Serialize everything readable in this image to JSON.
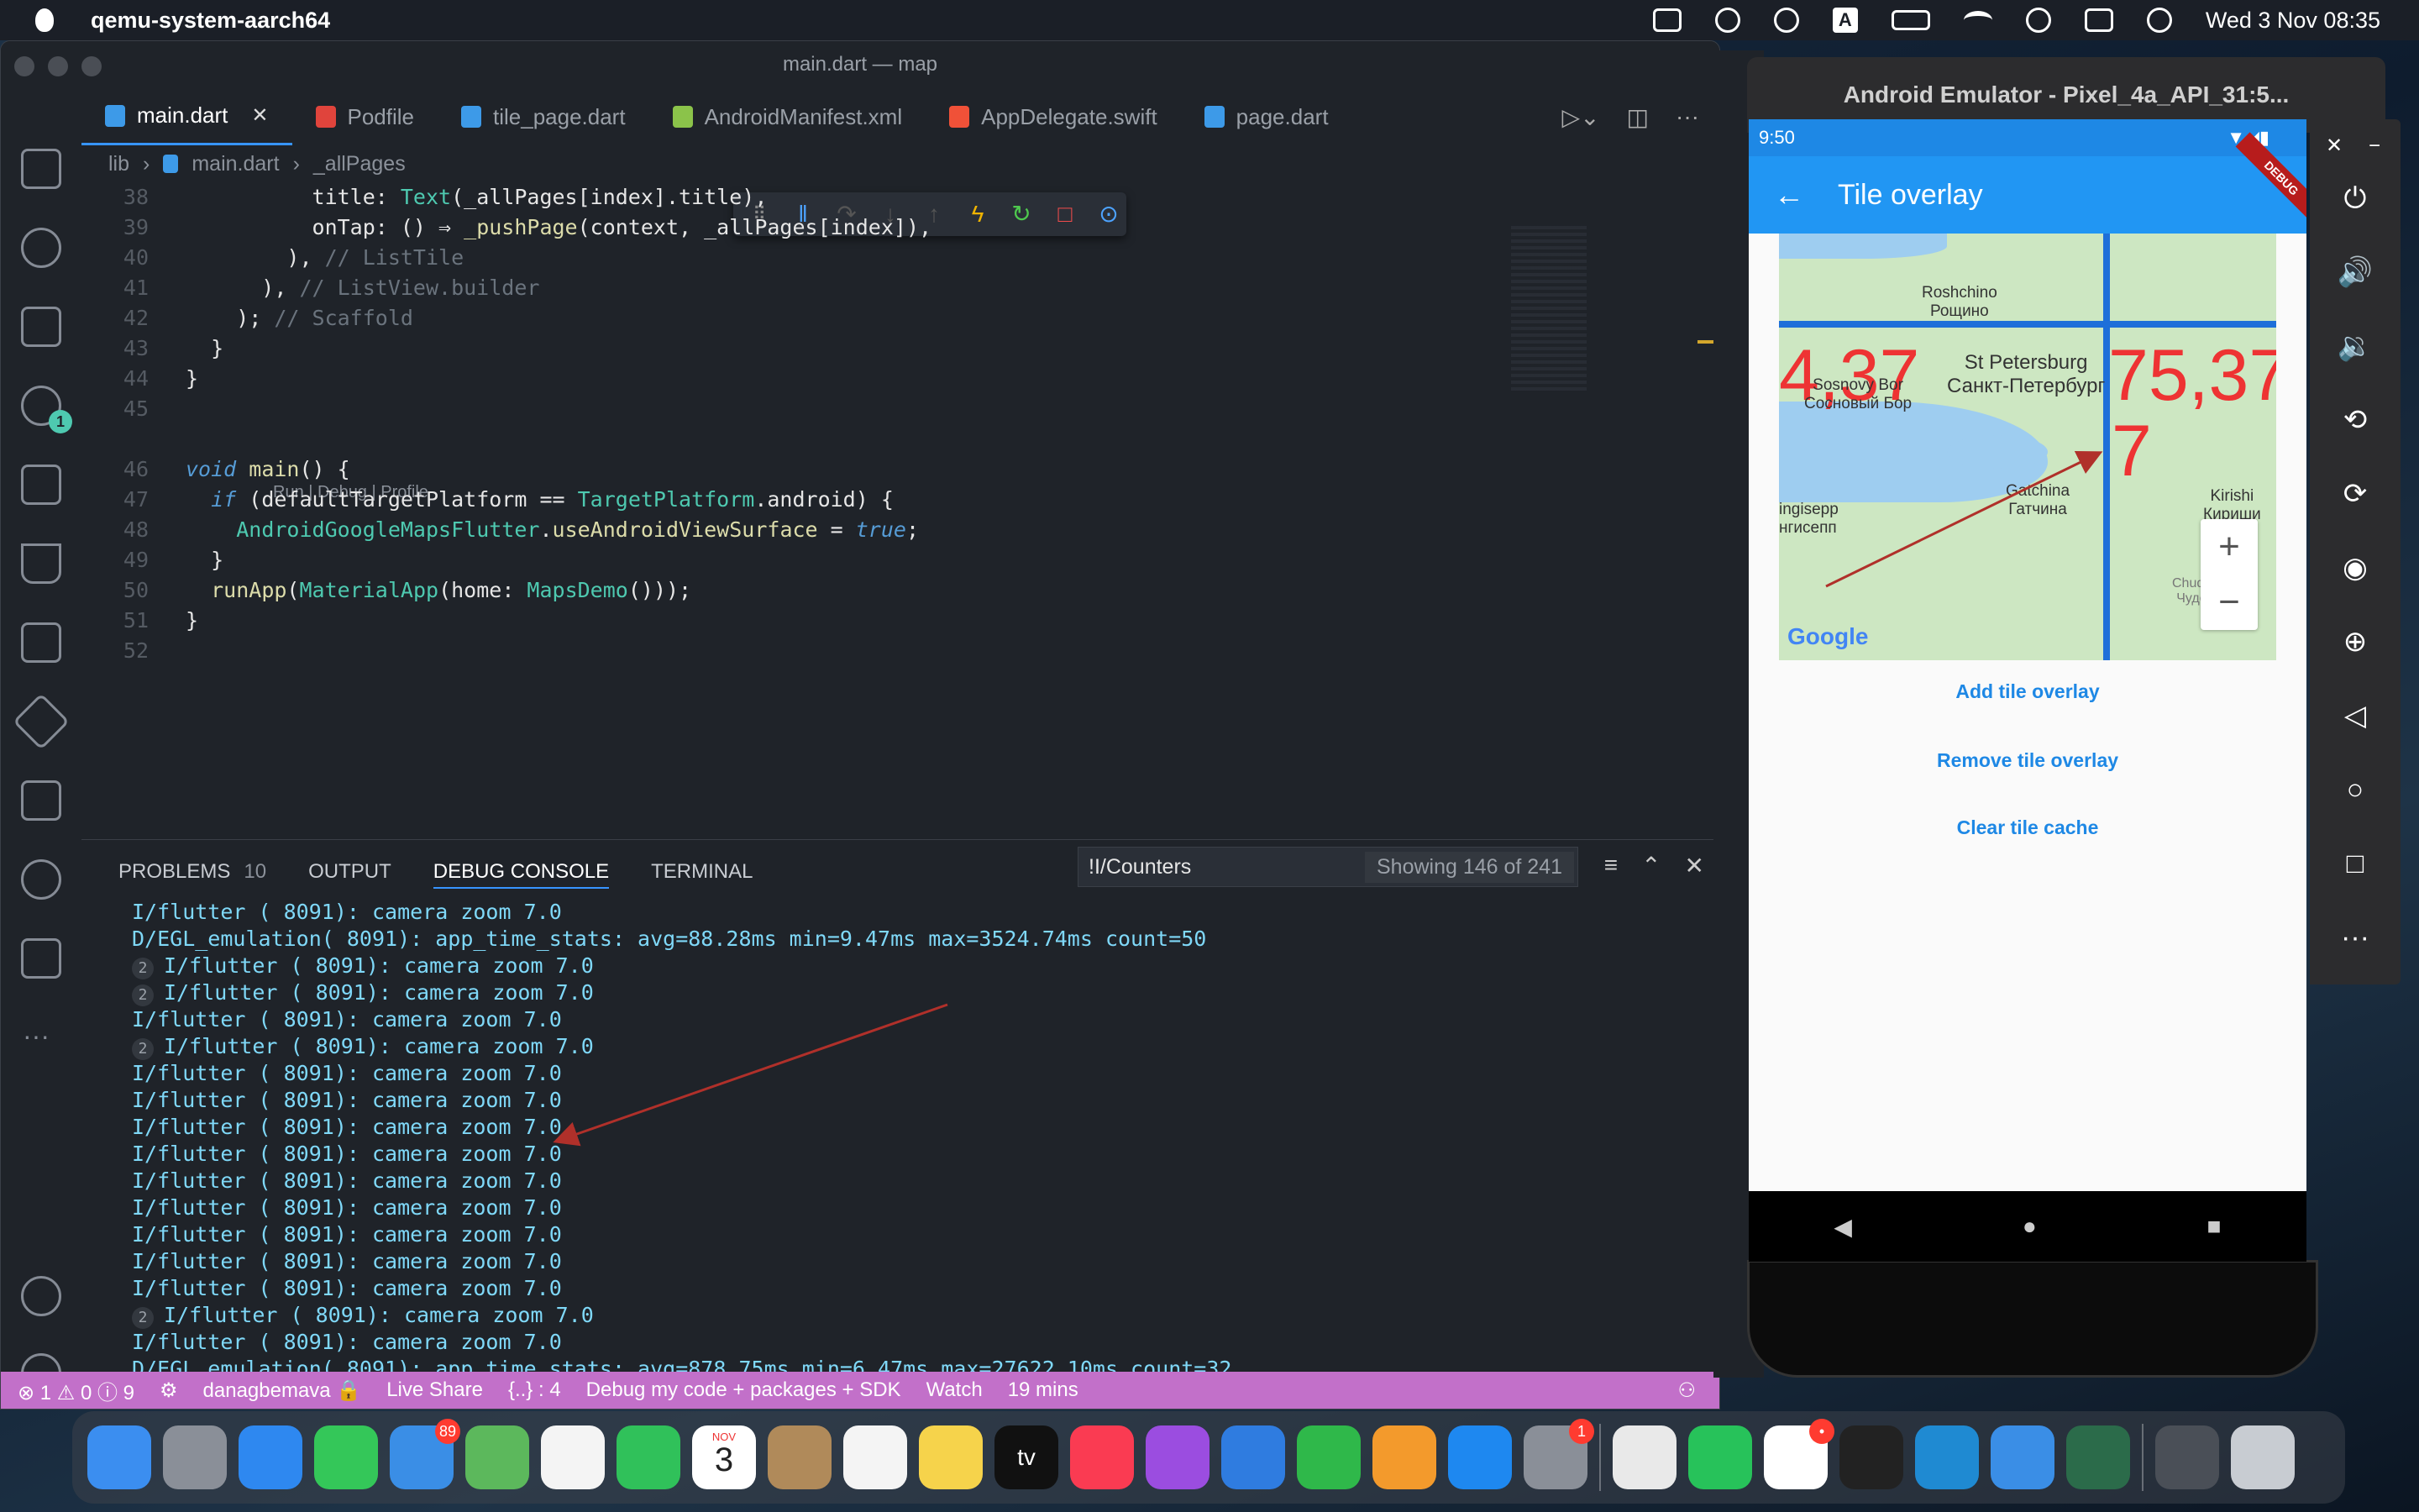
{
  "menubar": {
    "app": "qemu-system-aarch64",
    "datetime": "Wed 3 Nov  08:35",
    "input_icon": "A"
  },
  "vscode": {
    "window_title": "main.dart — map",
    "tabs": [
      {
        "label": "main.dart",
        "icon_color": "#3d9ae8",
        "active": true
      },
      {
        "label": "Podfile",
        "icon_color": "#e0443c",
        "active": false
      },
      {
        "label": "tile_page.dart",
        "icon_color": "#3d9ae8",
        "active": false
      },
      {
        "label": "AndroidManifest.xml",
        "icon_color": "#8bc34a",
        "active": false
      },
      {
        "label": "AppDelegate.swift",
        "icon_color": "#f05138",
        "active": false
      },
      {
        "label": "page.dart",
        "icon_color": "#3d9ae8",
        "active": false
      }
    ],
    "breadcrumb": [
      "lib",
      "main.dart",
      "_allPages"
    ],
    "codelens": "Run | Debug | Profile",
    "code": [
      {
        "ln": "38",
        "text": "          title: Text(_allPages[index].title),"
      },
      {
        "ln": "39",
        "text": "          onTap: () ⇒ _pushPage(context, _allPages[index]),"
      },
      {
        "ln": "40",
        "text": "        ), // ListTile"
      },
      {
        "ln": "41",
        "text": "      ), // ListView.builder"
      },
      {
        "ln": "42",
        "text": "    ); // Scaffold"
      },
      {
        "ln": "43",
        "text": "  }"
      },
      {
        "ln": "44",
        "text": "}"
      },
      {
        "ln": "45",
        "text": ""
      },
      {
        "ln": "46",
        "text": "void main() {"
      },
      {
        "ln": "47",
        "text": "  if (defaultTargetPlatform == TargetPlatform.android) {"
      },
      {
        "ln": "48",
        "text": "    AndroidGoogleMapsFlutter.useAndroidViewSurface = true;"
      },
      {
        "ln": "49",
        "text": "  }"
      },
      {
        "ln": "50",
        "text": "  runApp(MaterialApp(home: MapsDemo()));"
      },
      {
        "ln": "51",
        "text": "}"
      },
      {
        "ln": "52",
        "text": ""
      }
    ],
    "panel": {
      "tabs": [
        {
          "label": "PROBLEMS",
          "count": "10"
        },
        {
          "label": "OUTPUT",
          "count": ""
        },
        {
          "label": "DEBUG CONSOLE",
          "count": ""
        },
        {
          "label": "TERMINAL",
          "count": ""
        }
      ],
      "filter_value": "!I/Counters",
      "showing": "Showing 146 of 241",
      "console": [
        {
          "rep": "",
          "text": "I/flutter ( 8091): camera zoom 7.0"
        },
        {
          "rep": "",
          "text": "D/EGL_emulation( 8091): app_time_stats: avg=88.28ms min=9.47ms max=3524.74ms count=50"
        },
        {
          "rep": "2",
          "text": "I/flutter ( 8091): camera zoom 7.0"
        },
        {
          "rep": "2",
          "text": "I/flutter ( 8091): camera zoom 7.0"
        },
        {
          "rep": "",
          "text": "I/flutter ( 8091): camera zoom 7.0"
        },
        {
          "rep": "2",
          "text": "I/flutter ( 8091): camera zoom 7.0"
        },
        {
          "rep": "",
          "text": "I/flutter ( 8091): camera zoom 7.0"
        },
        {
          "rep": "",
          "text": "I/flutter ( 8091): camera zoom 7.0"
        },
        {
          "rep": "",
          "text": "I/flutter ( 8091): camera zoom 7.0"
        },
        {
          "rep": "",
          "text": "I/flutter ( 8091): camera zoom 7.0"
        },
        {
          "rep": "",
          "text": "I/flutter ( 8091): camera zoom 7.0"
        },
        {
          "rep": "",
          "text": "I/flutter ( 8091): camera zoom 7.0"
        },
        {
          "rep": "",
          "text": "I/flutter ( 8091): camera zoom 7.0"
        },
        {
          "rep": "",
          "text": "I/flutter ( 8091): camera zoom 7.0"
        },
        {
          "rep": "",
          "text": "I/flutter ( 8091): camera zoom 7.0"
        },
        {
          "rep": "2",
          "text": "I/flutter ( 8091): camera zoom 7.0"
        },
        {
          "rep": "",
          "text": "I/flutter ( 8091): camera zoom 7.0"
        },
        {
          "rep": "",
          "text": "D/EGL_emulation( 8091): app_time_stats: avg=878.75ms min=6.47ms max=27622.10ms count=32"
        }
      ]
    },
    "statusbar": {
      "problems": "⊗ 1 ⚠ 0 ⓘ 9",
      "user": "danagbemava 🔒",
      "live_share": "Live Share",
      "brackets": "{..} : 4",
      "debug_mode": "Debug my code + packages + SDK",
      "watch": "Watch",
      "time": "19 mins"
    }
  },
  "emulator": {
    "window_title": "Android Emulator - Pixel_4a_API_31:5...",
    "time": "9:50",
    "debug_banner": "DEBUG",
    "app_title": "Tile overlay",
    "map": {
      "places": [
        {
          "name": "Roshchino\nРощино"
        },
        {
          "name": "St Petersburg\nСанкт-Петербург"
        },
        {
          "name": "Sosnovy Bor\nСосновый Бор"
        },
        {
          "name": "Gatchina\nГатчина"
        },
        {
          "name": "ingisepp\nнгисепп"
        },
        {
          "name": "Kirishi\nКириши"
        },
        {
          "name": "Chudovo\nЧудово"
        }
      ],
      "tile_labels": [
        "4,37",
        "75,37",
        "7"
      ],
      "google": "Google",
      "zoom_in": "+",
      "zoom_out": "−"
    },
    "buttons": [
      "Add tile overlay",
      "Remove tile overlay",
      "Clear tile cache"
    ]
  },
  "dock": {
    "apps": [
      {
        "name": "finder",
        "color": "#3b8ef0",
        "badge": ""
      },
      {
        "name": "launchpad",
        "color": "#8a8f98",
        "badge": ""
      },
      {
        "name": "safari",
        "color": "#2e88f0",
        "badge": ""
      },
      {
        "name": "messages",
        "color": "#34c759",
        "badge": ""
      },
      {
        "name": "mail",
        "color": "#3a8ee6",
        "badge": "89"
      },
      {
        "name": "maps",
        "color": "#5cb85c",
        "badge": ""
      },
      {
        "name": "photos",
        "color": "#f4f4f4",
        "badge": ""
      },
      {
        "name": "facetime",
        "color": "#30c15a",
        "badge": ""
      },
      {
        "name": "calendar",
        "color": "#ffffff",
        "badge": ""
      },
      {
        "name": "contacts",
        "color": "#b08a5a",
        "badge": ""
      },
      {
        "name": "reminders",
        "color": "#f4f4f4",
        "badge": ""
      },
      {
        "name": "notes",
        "color": "#f6d34b",
        "badge": ""
      },
      {
        "name": "appletv",
        "color": "#111111",
        "badge": ""
      },
      {
        "name": "music",
        "color": "#fa3b52",
        "badge": ""
      },
      {
        "name": "podcasts",
        "color": "#9b4de0",
        "badge": ""
      },
      {
        "name": "keynote",
        "color": "#2f7ce0",
        "badge": ""
      },
      {
        "name": "numbers",
        "color": "#2fb84a",
        "badge": ""
      },
      {
        "name": "pages",
        "color": "#f39a2c",
        "badge": ""
      },
      {
        "name": "appstore",
        "color": "#1e88f0",
        "badge": ""
      },
      {
        "name": "systemprefs",
        "color": "#8a8f98",
        "badge": "1"
      },
      {
        "name": "chrome",
        "color": "#e9e9e9",
        "badge": ""
      },
      {
        "name": "whatsapp",
        "color": "#27c25a",
        "badge": ""
      },
      {
        "name": "slack",
        "color": "#ffffff",
        "badge": "•"
      },
      {
        "name": "terminal",
        "color": "#222222",
        "badge": ""
      },
      {
        "name": "vscode",
        "color": "#1f8ad2",
        "badge": ""
      },
      {
        "name": "xcode",
        "color": "#3a8ee6",
        "badge": ""
      },
      {
        "name": "androidstudio",
        "color": "#2b6b4a",
        "badge": ""
      },
      {
        "name": "downloads",
        "color": "#4a4f57",
        "badge": ""
      },
      {
        "name": "trash",
        "color": "#c8ccd2",
        "badge": ""
      }
    ],
    "calendar_month": "NOV",
    "calendar_day": "3",
    "appletv_label": "tv"
  }
}
